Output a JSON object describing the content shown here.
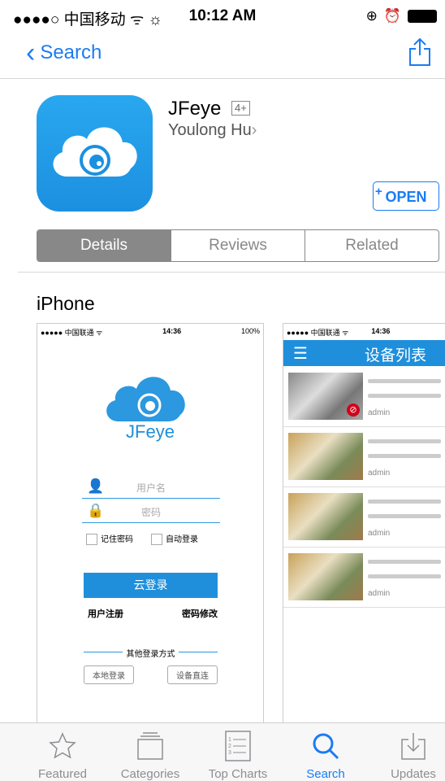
{
  "status_bar": {
    "carrier": "●●●●○ 中国移动 ᯤ ☼",
    "time": "10:12 AM"
  },
  "nav": {
    "back_label": "Search"
  },
  "app": {
    "name": "JFeye",
    "age_rating": "4+",
    "developer": "Youlong Hu",
    "open_label": "OPEN"
  },
  "segments": [
    "Details",
    "Reviews",
    "Related"
  ],
  "section_title": "iPhone",
  "screenshot1": {
    "status_left": "●●●●● 中国联通 ᯤ",
    "status_time": "14:36",
    "status_right": "100%",
    "logo_text": "JFeye",
    "username_placeholder": "用户名",
    "password_placeholder": "密码",
    "remember": "记住密码",
    "auto_login": "自动登录",
    "login_button": "云登录",
    "register": "用户注册",
    "change_password": "密码修改",
    "other_methods": "其他登录方式",
    "local_login": "本地登录",
    "direct_connect": "设备直连"
  },
  "screenshot2": {
    "status_left": "●●●●● 中国联通 ᯤ",
    "status_time": "14:36",
    "title": "设备列表",
    "devices": [
      {
        "user": "admin"
      },
      {
        "user": "admin"
      },
      {
        "user": "admin"
      },
      {
        "user": "admin"
      }
    ]
  },
  "tabs": [
    {
      "label": "Featured",
      "icon": "star-icon"
    },
    {
      "label": "Categories",
      "icon": "categories-icon"
    },
    {
      "label": "Top Charts",
      "icon": "list-icon"
    },
    {
      "label": "Search",
      "icon": "search-icon",
      "active": true
    },
    {
      "label": "Updates",
      "icon": "download-icon"
    }
  ],
  "colors": {
    "accent": "#1a7cf3",
    "app_blue": "#1f8fdc"
  }
}
